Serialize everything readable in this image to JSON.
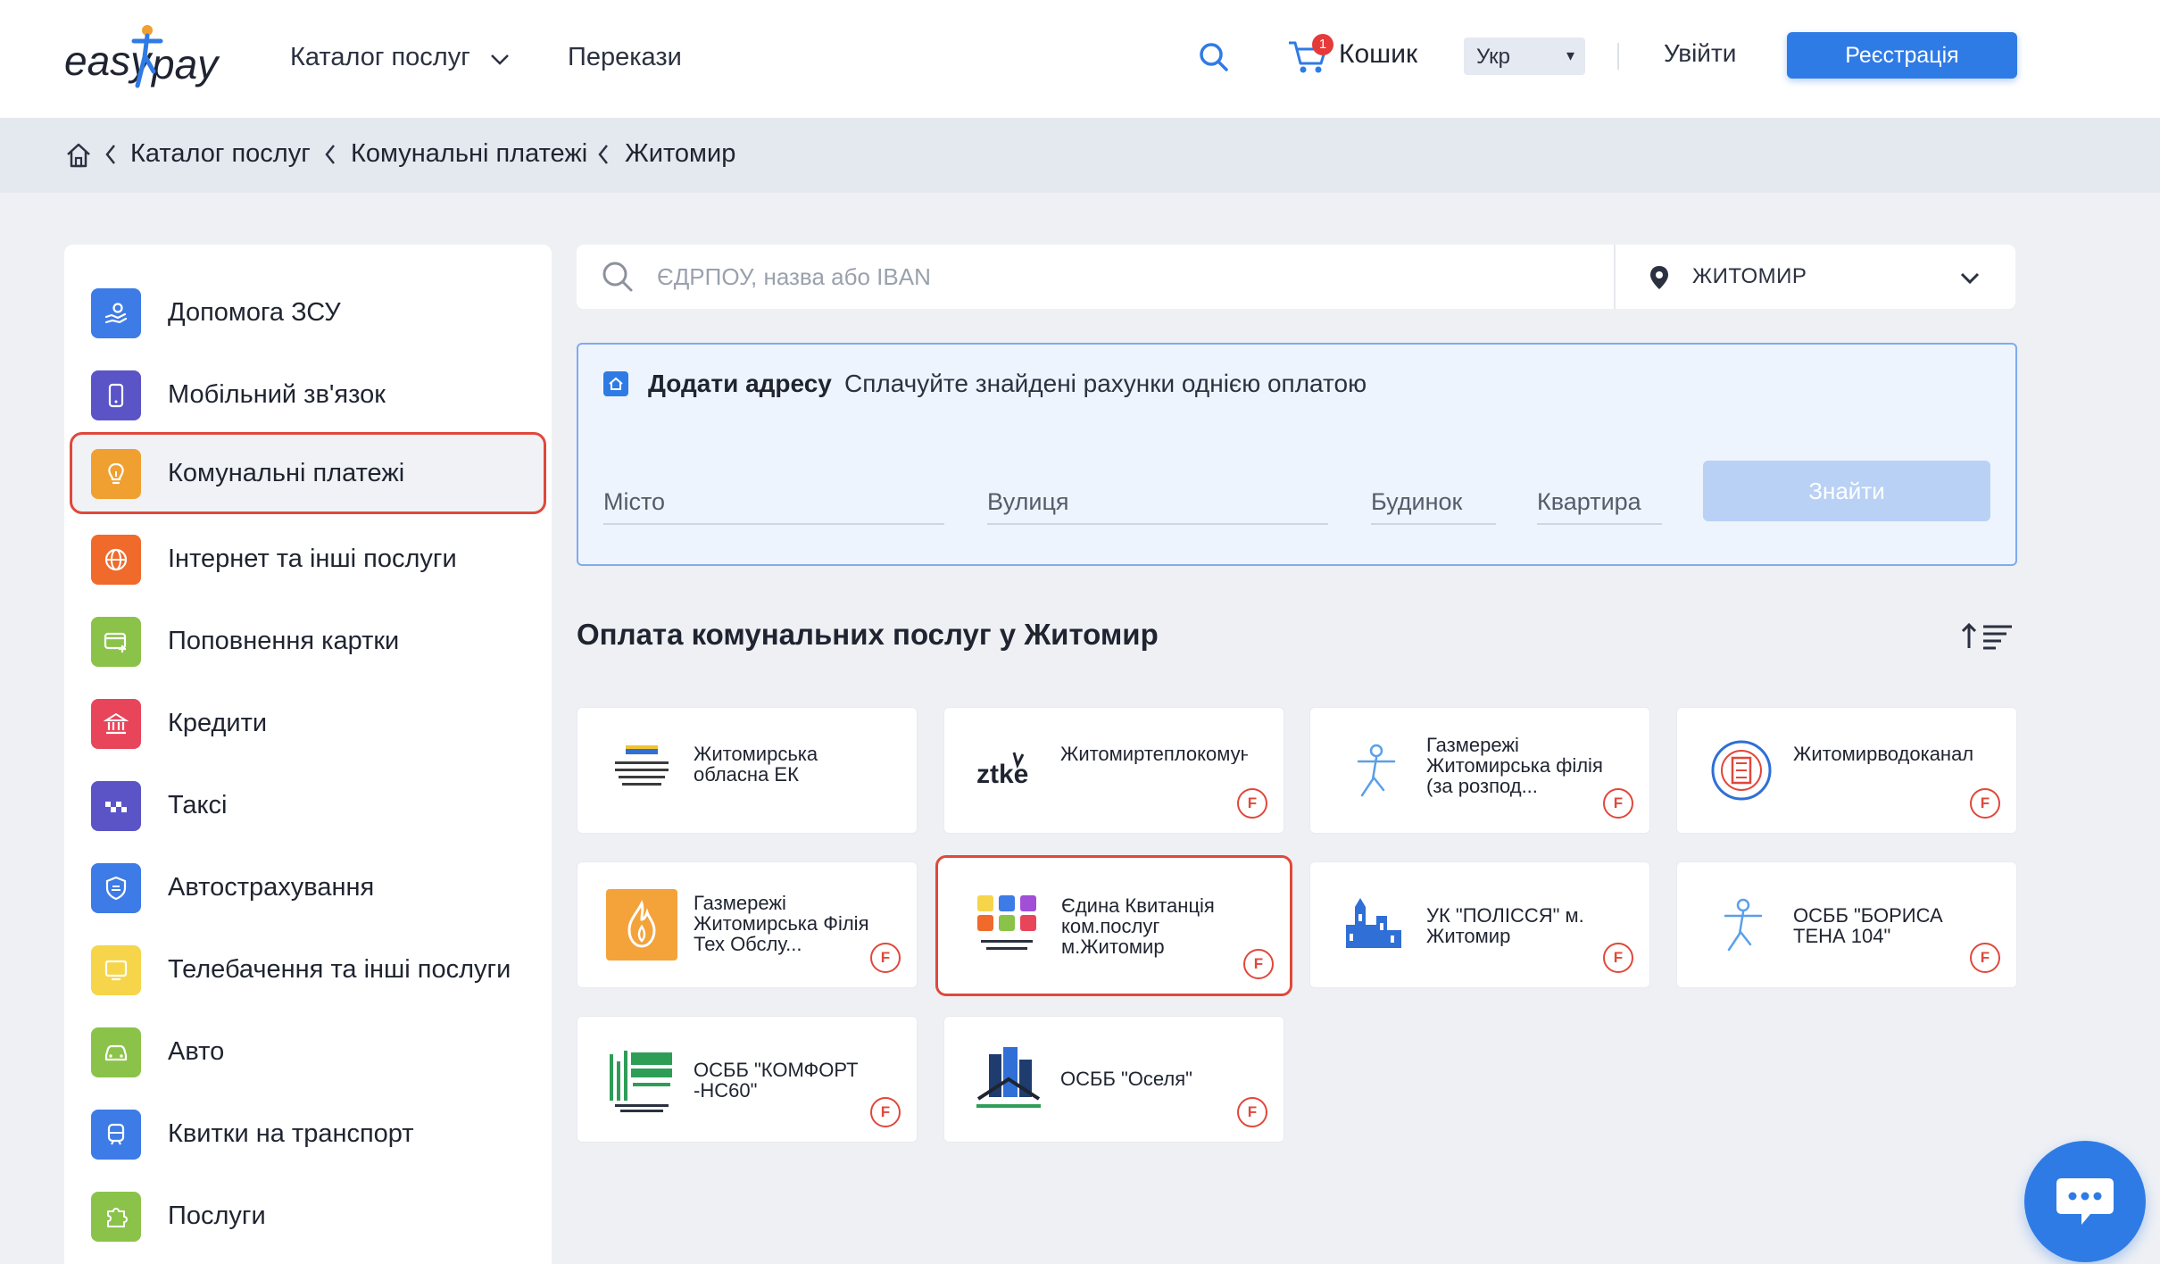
{
  "header": {
    "logo_text": "easypay",
    "nav": {
      "catalog": "Каталог послуг",
      "transfers": "Перекази"
    },
    "cart_label": "Кошик",
    "cart_count": "1",
    "language": "Укр",
    "login": "Увійти",
    "register": "Реєстрація",
    "colors": {
      "accent": "#2f7be5",
      "badge": "#e53a3a"
    }
  },
  "breadcrumb": {
    "items": [
      "Каталог послуг",
      "Комунальні платежі",
      "Житомир"
    ]
  },
  "sidebar": {
    "items": [
      {
        "label": "Допомога ЗСУ",
        "icon": "hand-heart-icon",
        "color": "#3d7be6"
      },
      {
        "label": "Мобільний зв'язок",
        "icon": "phone-icon",
        "color": "#5a54c7"
      },
      {
        "label": "Комунальні платежі",
        "icon": "lightbulb-icon",
        "color": "#f0a030",
        "active": true
      },
      {
        "label": "Інтернет та інші послуги",
        "icon": "globe-icon",
        "color": "#ef6a2b"
      },
      {
        "label": "Поповнення картки",
        "icon": "card-plus-icon",
        "color": "#8bc34a"
      },
      {
        "label": "Кредити",
        "icon": "bank-icon",
        "color": "#e8455a"
      },
      {
        "label": "Таксі",
        "icon": "taxi-icon",
        "color": "#5a54c7"
      },
      {
        "label": "Автострахування",
        "icon": "car-shield-icon",
        "color": "#3d7be6"
      },
      {
        "label": "Телебачення та інші послуги",
        "icon": "tv-icon",
        "color": "#f6d54a"
      },
      {
        "label": "Авто",
        "icon": "car-icon",
        "color": "#8bc34a"
      },
      {
        "label": "Квитки на транспорт",
        "icon": "train-icon",
        "color": "#3d7be6"
      },
      {
        "label": "Послуги",
        "icon": "puzzle-icon",
        "color": "#8bc34a"
      }
    ]
  },
  "search": {
    "placeholder": "ЄДРПОУ, назва або IBAN",
    "value": "",
    "city": "ЖИТОМИР"
  },
  "address_panel": {
    "title": "Додати адресу",
    "subtitle": "Сплачуйте знайдені рахунки однією оплатою",
    "fields": {
      "city": "Місто",
      "street": "Вулиця",
      "house": "Будинок",
      "apartment": "Квартира"
    },
    "find_button": "Знайти"
  },
  "providers_section": {
    "title": "Оплата комунальних послуг у Житомир",
    "cards": [
      {
        "name": "Житомирська обласна ЕК",
        "logo": "zhytomyr-oblenergo-logo",
        "badge": ""
      },
      {
        "name": "Житомиртеплокомуненерго",
        "logo": "ztke-logo",
        "badge": "F"
      },
      {
        "name": "Газмережі Житомирська філія (за розпод...",
        "logo": "person-star-logo",
        "badge": "F"
      },
      {
        "name": "Житомирводоканал",
        "logo": "vodokanal-seal-logo",
        "badge": "F"
      },
      {
        "name": "Газмережі Житомирська Філія Тех Обслу...",
        "logo": "gas-flame-logo",
        "badge": "F"
      },
      {
        "name": "Єдина Квитанція ком.послуг м.Житомир",
        "logo": "edyna-kvytantsia-logo",
        "badge": "F",
        "highlighted": true
      },
      {
        "name": "УК \"ПОЛІССЯ\" м. Житомир",
        "logo": "polissia-logo",
        "badge": "F"
      },
      {
        "name": "ОСББ \"БОРИСА ТЕНА 104\"",
        "logo": "person-star-logo",
        "badge": "F"
      },
      {
        "name": "ОСББ \"КОМФОРТ -НС60\"",
        "logo": "osbb-komfort-logo",
        "badge": "F"
      },
      {
        "name": "ОСББ \"Оселя\"",
        "logo": "osbb-oselia-logo",
        "badge": "F"
      }
    ]
  }
}
